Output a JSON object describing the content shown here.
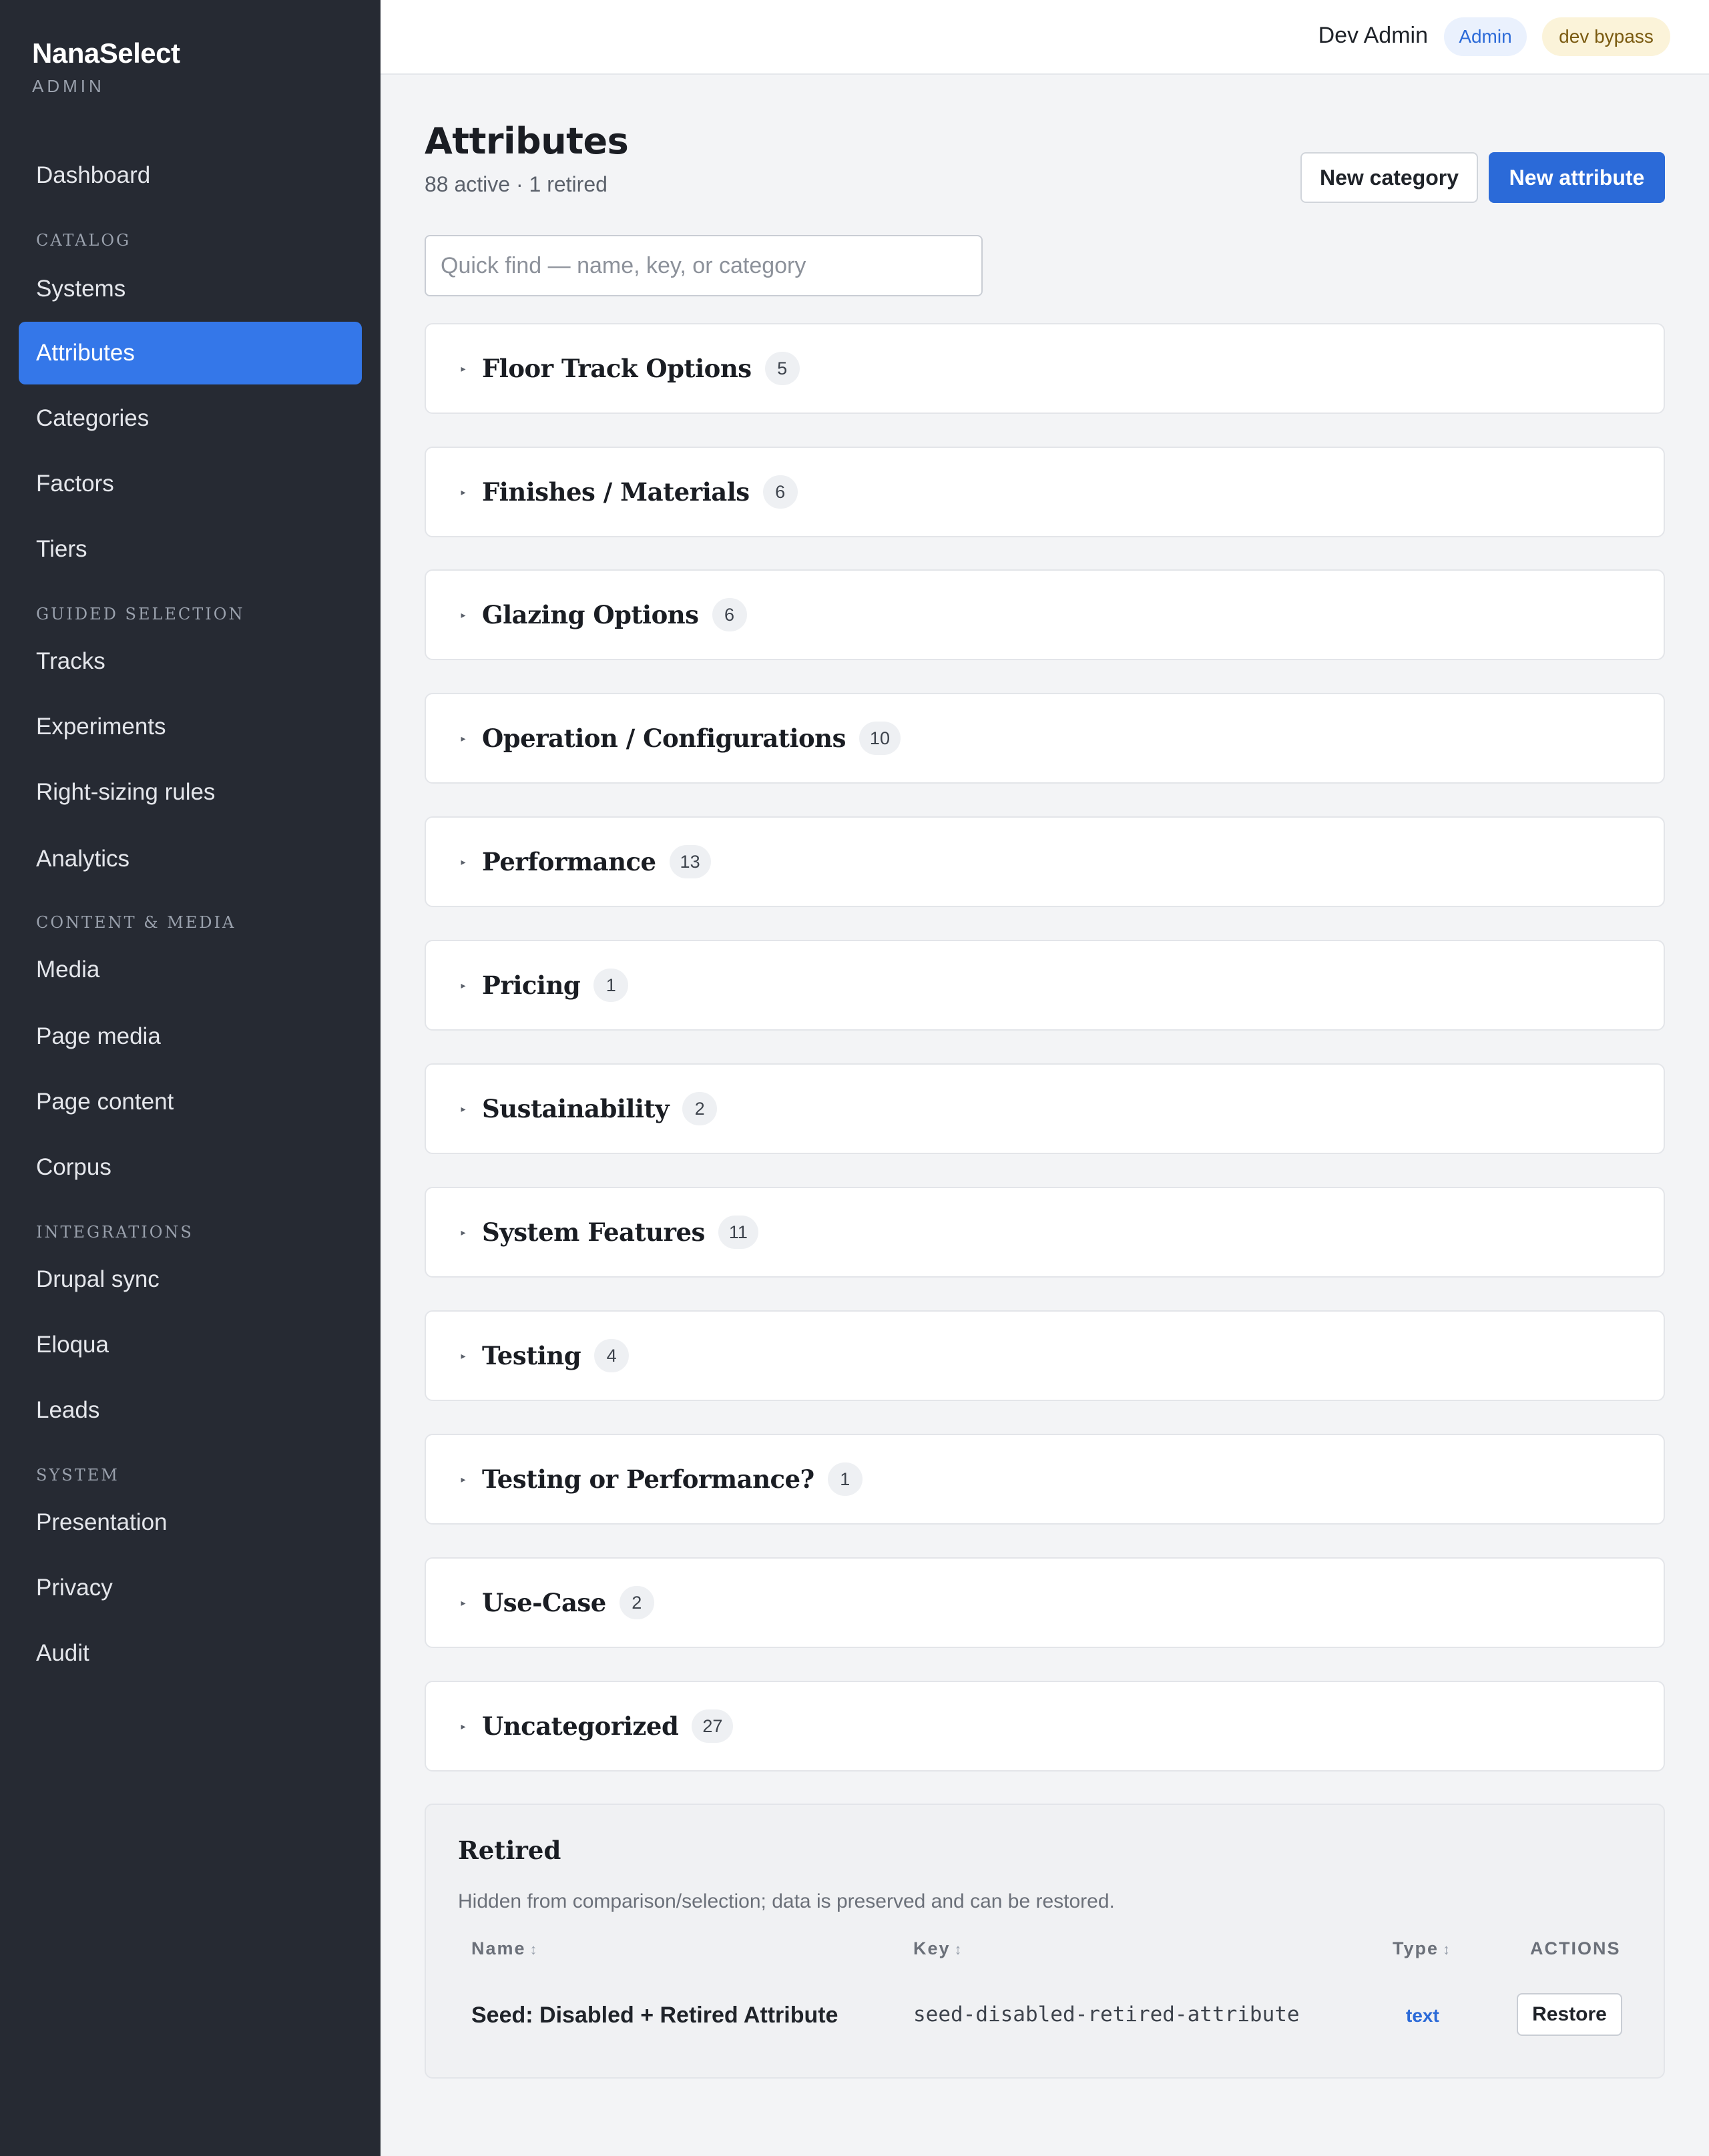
{
  "brand": {
    "name": "NanaSelect",
    "subtitle": "ADMIN"
  },
  "sidebar": {
    "items": [
      {
        "label": "Dashboard",
        "active": false
      },
      {
        "label": "Systems",
        "active": false
      },
      {
        "label": "Attributes",
        "active": true
      },
      {
        "label": "Categories",
        "active": false
      },
      {
        "label": "Factors",
        "active": false
      },
      {
        "label": "Tiers",
        "active": false
      },
      {
        "label": "Tracks",
        "active": false
      },
      {
        "label": "Experiments",
        "active": false
      },
      {
        "label": "Right-sizing rules",
        "active": false
      },
      {
        "label": "Analytics",
        "active": false
      },
      {
        "label": "Media",
        "active": false
      },
      {
        "label": "Page media",
        "active": false
      },
      {
        "label": "Page content",
        "active": false
      },
      {
        "label": "Corpus",
        "active": false
      },
      {
        "label": "Drupal sync",
        "active": false
      },
      {
        "label": "Eloqua",
        "active": false
      },
      {
        "label": "Leads",
        "active": false
      },
      {
        "label": "Presentation",
        "active": false
      },
      {
        "label": "Privacy",
        "active": false
      },
      {
        "label": "Audit",
        "active": false
      }
    ],
    "sections": [
      "CATALOG",
      "GUIDED SELECTION",
      "CONTENT & MEDIA",
      "INTEGRATIONS",
      "SYSTEM"
    ]
  },
  "topbar": {
    "user_name": "Dev Admin",
    "role_badge": "Admin",
    "mode_badge": "dev bypass"
  },
  "page": {
    "title": "Attributes",
    "subtitle": "88 active · 1 retired",
    "new_category_label": "New category",
    "new_attribute_label": "New attribute",
    "search_placeholder": "Quick find — name, key, or category",
    "search_value": ""
  },
  "groups": [
    {
      "name": "Floor Track Options",
      "count": "5"
    },
    {
      "name": "Finishes / Materials",
      "count": "6"
    },
    {
      "name": "Glazing Options",
      "count": "6"
    },
    {
      "name": "Operation / Configurations",
      "count": "10"
    },
    {
      "name": "Performance",
      "count": "13"
    },
    {
      "name": "Pricing",
      "count": "1"
    },
    {
      "name": "Sustainability",
      "count": "2"
    },
    {
      "name": "System Features",
      "count": "11"
    },
    {
      "name": "Testing",
      "count": "4"
    },
    {
      "name": "Testing or Performance?",
      "count": "1"
    },
    {
      "name": "Use-Case",
      "count": "2"
    },
    {
      "name": "Uncategorized",
      "count": "27"
    }
  ],
  "retired": {
    "title": "Retired",
    "description": "Hidden from comparison/selection; data is preserved and can be restored.",
    "columns": {
      "name": "Name",
      "key": "Key",
      "type": "Type",
      "actions": "ACTIONS",
      "sort_glyph": "↕"
    },
    "rows": [
      {
        "name": "Seed: Disabled + Retired Attribute",
        "key": "seed-disabled-retired-attribute",
        "type": "text",
        "action": "Restore"
      }
    ]
  },
  "colors": {
    "sidebar_bg": "#262a33",
    "accent": "#2b6ad8",
    "active_nav": "#3477e9",
    "page_bg": "#f3f4f6"
  },
  "icons": {
    "group_caret": "caret-right-icon",
    "sort": "sort-icon"
  }
}
